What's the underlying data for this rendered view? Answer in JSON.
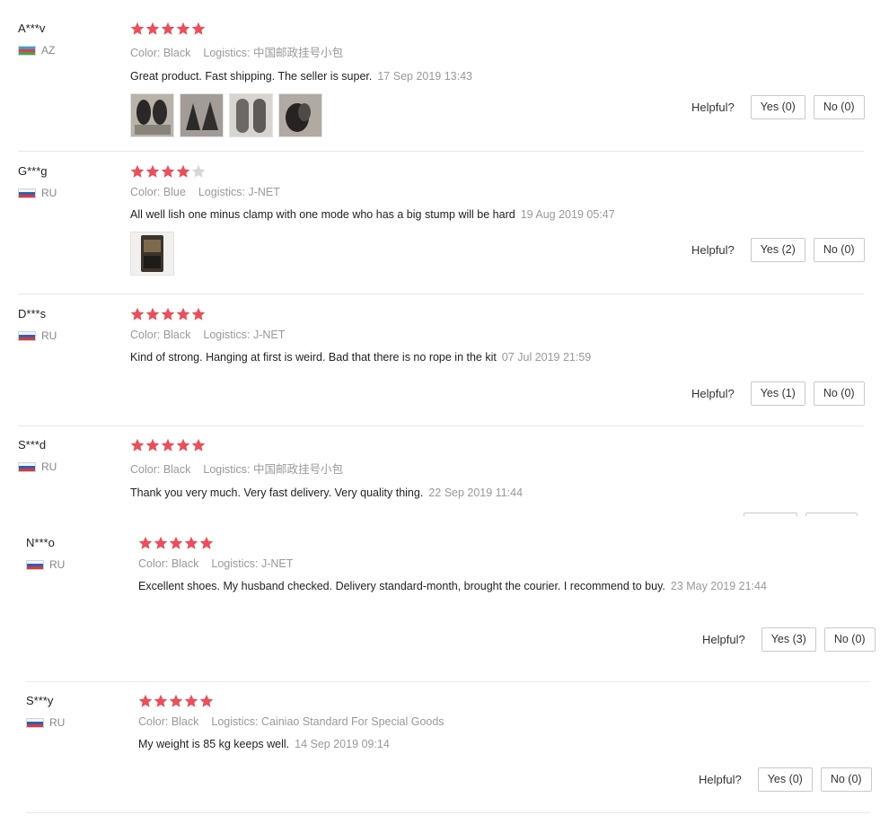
{
  "helpful_label": "Helpful?",
  "colors": {
    "star_filled": "#e8505b",
    "star_empty": "#d6d6d6"
  },
  "reviews": [
    {
      "user": "A***v",
      "country": "AZ",
      "flag": "azerbaijan-flag-icon",
      "rating": 5,
      "color": "Color: Black",
      "logistics": "Logistics: 中国邮政挂号小包",
      "text": "Great product. Fast shipping. The seller is super.",
      "date": "17 Sep 2019 13:43",
      "yes": "Yes (0)",
      "no": "No (0)",
      "photo_count": 4
    },
    {
      "user": "G***g",
      "country": "RU",
      "flag": "russia-flag-icon",
      "rating": 4,
      "color": "Color: Blue",
      "logistics": "Logistics: J-NET",
      "text": "All well lish one minus clamp with one mode who has a big stump will be hard",
      "date": "19 Aug 2019 05:47",
      "yes": "Yes (2)",
      "no": "No (0)",
      "photo_count": 1
    },
    {
      "user": "D***s",
      "country": "RU",
      "flag": "russia-flag-icon",
      "rating": 5,
      "color": "Color: Black",
      "logistics": "Logistics: J-NET",
      "text": "Kind of strong. Hanging at first is weird. Bad that there is no rope in the kit",
      "date": "07 Jul 2019 21:59",
      "yes": "Yes (1)",
      "no": "No (0)",
      "photo_count": 0
    },
    {
      "user": "S***d",
      "country": "RU",
      "flag": "russia-flag-icon",
      "rating": 5,
      "color": "Color: Black",
      "logistics": "Logistics: 中国邮政挂号小包",
      "text": "Thank you very much. Very fast delivery. Very quality thing.",
      "date": "22 Sep 2019 11:44",
      "yes": "",
      "no": "",
      "photo_count": 0
    },
    {
      "user": "N***o",
      "country": "RU",
      "flag": "russia-flag-icon",
      "rating": 5,
      "color": "Color: Black",
      "logistics": "Logistics: J-NET",
      "text": "Excellent shoes. My husband checked. Delivery standard-month, brought the courier. I recommend to buy.",
      "date": "23 May 2019 21:44",
      "yes": "Yes (3)",
      "no": "No (0)",
      "photo_count": 0
    },
    {
      "user": "S***y",
      "country": "RU",
      "flag": "russia-flag-icon",
      "rating": 5,
      "color": "Color: Black",
      "logistics": "Logistics: Cainiao Standard For Special Goods",
      "text": "My weight is 85 kg keeps well.",
      "date": "14 Sep 2019 09:14",
      "yes": "Yes (0)",
      "no": "No (0)",
      "photo_count": 0
    }
  ]
}
